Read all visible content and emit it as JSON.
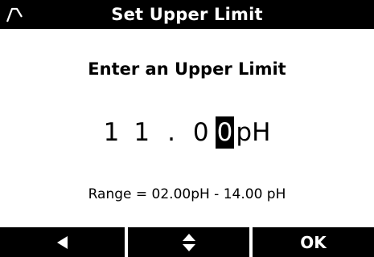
{
  "title_bar": {
    "icon": "stability-icon",
    "title": "Set Upper Limit"
  },
  "prompt": "Enter an Upper Limit",
  "value": {
    "digits": [
      "1",
      "1",
      ".",
      "0",
      "0"
    ],
    "selected_index": 4,
    "unit": "pH"
  },
  "range_text": "Range = 02.00pH - 14.00 pH",
  "softkeys": {
    "left_icon": "left-arrow-icon",
    "middle_icon": "up-down-arrows-icon",
    "right_label": "OK"
  }
}
